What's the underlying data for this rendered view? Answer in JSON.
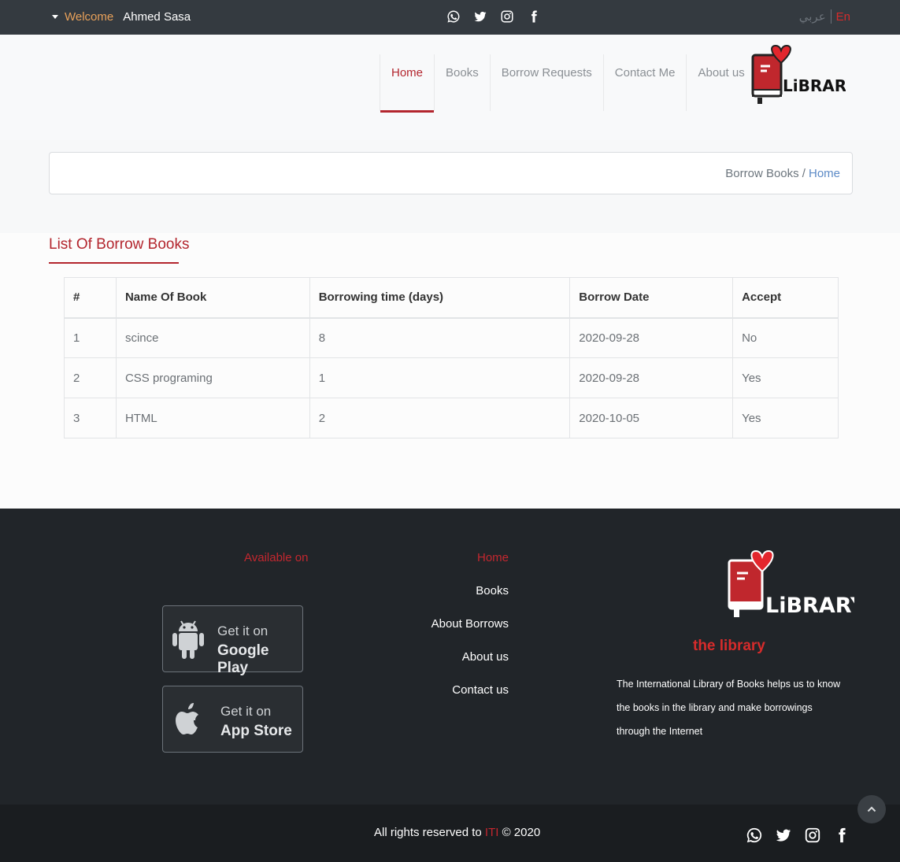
{
  "topbar": {
    "welcome_label": "Welcome",
    "user_name": "Ahmed Sasa",
    "lang_ar": "عربي",
    "lang_en": "En"
  },
  "nav": {
    "items": [
      {
        "label": "Home",
        "active": true
      },
      {
        "label": "Books"
      },
      {
        "label": "Borrow Requests"
      },
      {
        "label": "Contact Me"
      },
      {
        "label": "About us"
      }
    ]
  },
  "breadcrumb": {
    "current": "Borrow Books /",
    "home": "Home"
  },
  "main": {
    "title": "List Of Borrow Books",
    "columns": [
      "#",
      "Name Of Book",
      "Borrowing time (days)",
      "Borrow Date",
      "Accept"
    ],
    "rows": [
      [
        "1",
        "scince",
        "8",
        "2020-09-28",
        "No"
      ],
      [
        "2",
        "CSS programing",
        "1",
        "2020-09-28",
        "Yes"
      ],
      [
        "3",
        "HTML",
        "2",
        "2020-10-05",
        "Yes"
      ]
    ]
  },
  "footer": {
    "available_on": "Available on",
    "google_play": {
      "line1": "Get it on",
      "line2": "Google Play"
    },
    "app_store": {
      "line1": "Get it on",
      "line2": "App Store"
    },
    "links": [
      {
        "label": "Home",
        "active": true
      },
      {
        "label": "Books"
      },
      {
        "label": "About Borrows"
      },
      {
        "label": "About us"
      },
      {
        "label": "Contact us"
      }
    ],
    "brand": "the library",
    "description": "The International Library of Books helps us to know the books in the library and make borrowings through the Internet",
    "copyright_prefix": "All rights reserved to",
    "copyright_org": "ITI",
    "copyright_suffix": "© 2020"
  },
  "colors": {
    "accent": "#b3262e",
    "topbar_bg": "#343a40",
    "footer_bg": "#212529"
  },
  "icons": [
    "whatsapp-icon",
    "twitter-icon",
    "instagram-icon",
    "facebook-icon",
    "android-icon",
    "apple-icon",
    "chevron-up-icon",
    "caret-down-icon"
  ]
}
